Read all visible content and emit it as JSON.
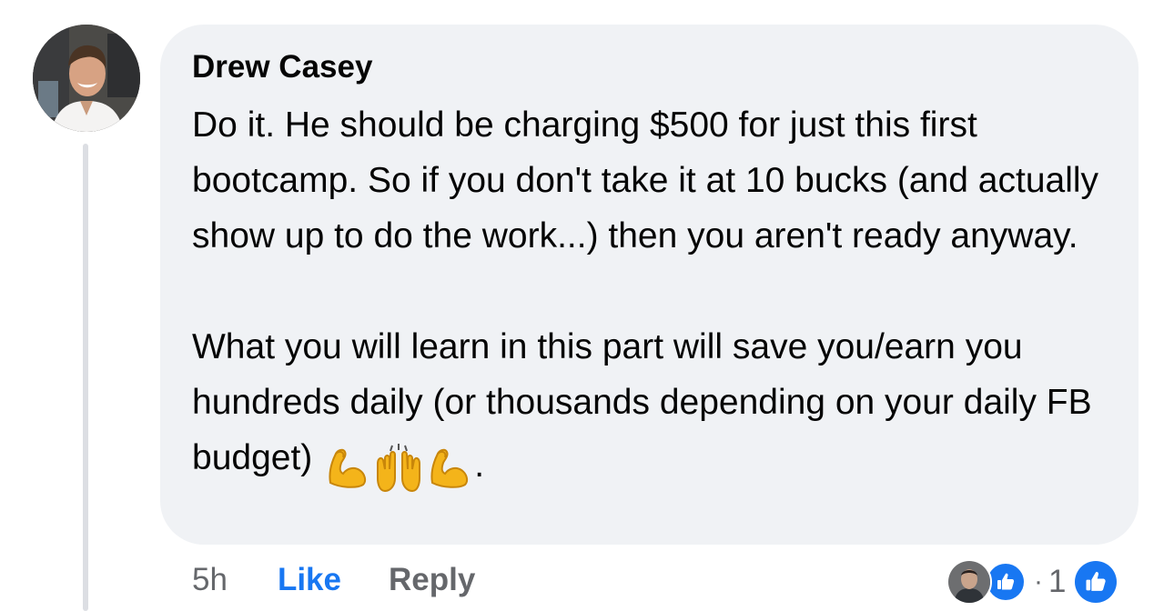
{
  "comment": {
    "author": "Drew Casey",
    "paragraphs": [
      "Do it. He should be charging $500 for just this first bootcamp. So if you don't take it at 10 bucks (and actually show up to do the work...) then you aren't ready anyway.",
      "What you will learn in this part will save you/earn you hundreds daily (or thousands depending on your daily FB budget)"
    ],
    "emojis": [
      "flexed-biceps",
      "raising-hands",
      "flexed-biceps"
    ],
    "trailing": "."
  },
  "actions": {
    "timestamp": "5h",
    "like_label": "Like",
    "reply_label": "Reply"
  },
  "reactions": {
    "dot": "·",
    "count": "1",
    "type": "like-icon"
  },
  "colors": {
    "accent": "#1877f2",
    "bubble": "#f0f2f5",
    "muted": "#65676b",
    "text": "#050505"
  }
}
